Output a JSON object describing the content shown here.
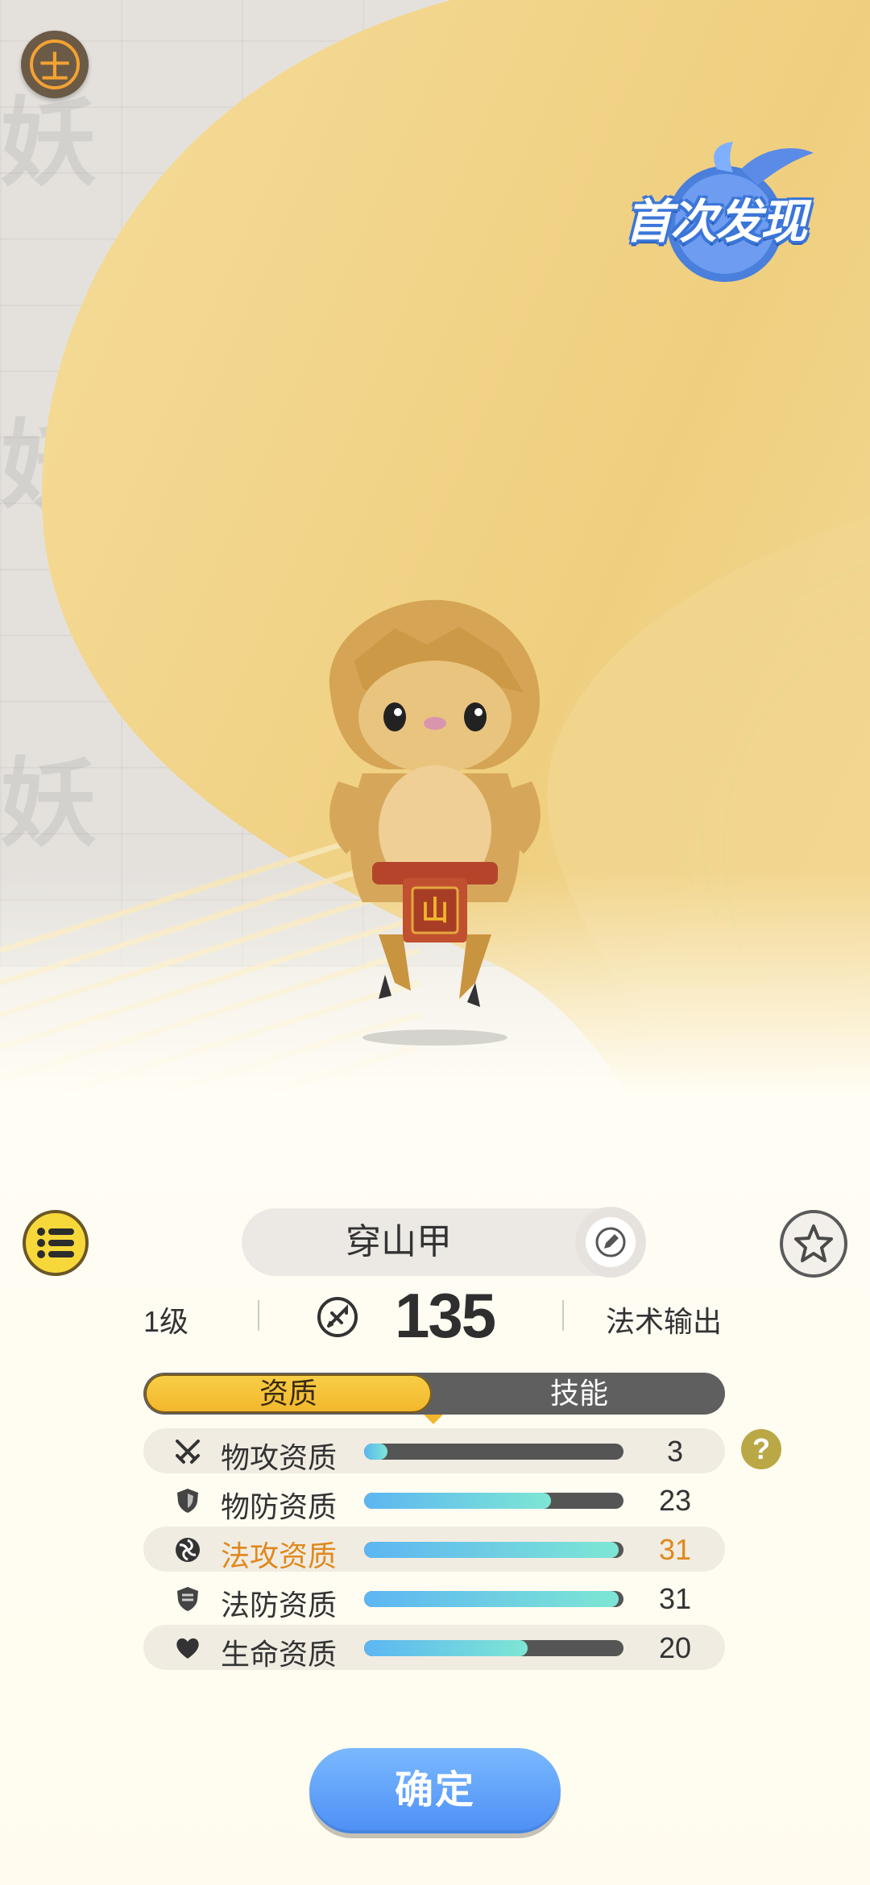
{
  "badge": {
    "text": "首次发现"
  },
  "seal": {
    "glyph": "士"
  },
  "creature": {
    "name": "穿山甲",
    "apron_glyph": "山"
  },
  "info": {
    "level": "1级",
    "power": "135",
    "role": "法术输出"
  },
  "tabs": {
    "active": "资质",
    "inactive": "技能"
  },
  "stats": [
    {
      "label": "物攻资质",
      "value": "3",
      "fill": 0.09,
      "icon": "crossed-swords-icon"
    },
    {
      "label": "物防资质",
      "value": "23",
      "fill": 0.72,
      "icon": "shield-icon"
    },
    {
      "label": "法攻资质",
      "value": "31",
      "fill": 0.98,
      "icon": "magic-orb-icon"
    },
    {
      "label": "法防资质",
      "value": "31",
      "fill": 0.98,
      "icon": "magic-shield-icon"
    },
    {
      "label": "生命资质",
      "value": "20",
      "fill": 0.63,
      "icon": "heart-icon"
    }
  ],
  "help": {
    "glyph": "?"
  },
  "confirm": {
    "label": "确定"
  },
  "colors": {
    "accent_gold": "#f2b72c",
    "bar_start": "#5cb6f2",
    "bar_end": "#7ee6d4",
    "highlight": "#e0891e",
    "confirm_blue": "#4d8ff5"
  }
}
